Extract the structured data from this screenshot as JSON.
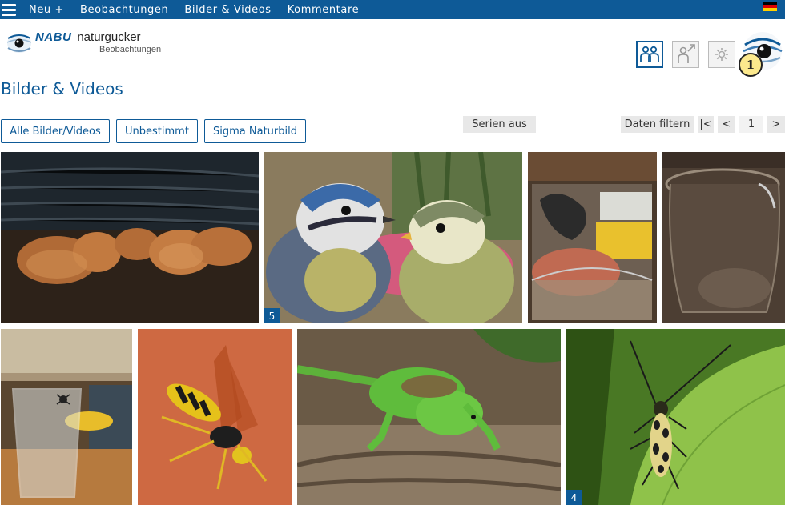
{
  "nav": {
    "items": [
      "Neu +",
      "Beobachtungen",
      "Bilder & Videos",
      "Kommentare"
    ],
    "flag_colors": [
      "#000000",
      "#dd0000",
      "#ffce00"
    ]
  },
  "header": {
    "logo_nabu": "NABU",
    "logo_naturgucker": "naturgucker",
    "logo_sub": "Beobachtungen",
    "buttons": [
      {
        "icon": "group-icon"
      },
      {
        "icon": "user-share-icon"
      },
      {
        "icon": "settings-icon"
      }
    ],
    "profile_badge": "1"
  },
  "page": {
    "title": "Bilder & Videos"
  },
  "filters": {
    "buttons": [
      "Alle Bilder/Videos",
      "Unbestimmt",
      "Sigma Naturbild"
    ],
    "series": "Serien aus",
    "data_filter": "Daten filtern",
    "pager": {
      "first": "|<",
      "prev": "<",
      "page": "1",
      "next": ">"
    }
  },
  "gallery": {
    "items": [
      {
        "subject": "bracket fungus on wood"
      },
      {
        "subject": "blue tits",
        "count": "5"
      },
      {
        "subject": "spider in glass jar"
      },
      {
        "subject": "glass jar"
      },
      {
        "subject": "spider on drinking glass"
      },
      {
        "subject": "wasp on orange wall"
      },
      {
        "subject": "green lizard on bark"
      },
      {
        "subject": "longhorn beetle on leaf",
        "count": "4"
      }
    ]
  },
  "colors": {
    "brand": "#0e5a97",
    "badge": "#fce98d"
  }
}
